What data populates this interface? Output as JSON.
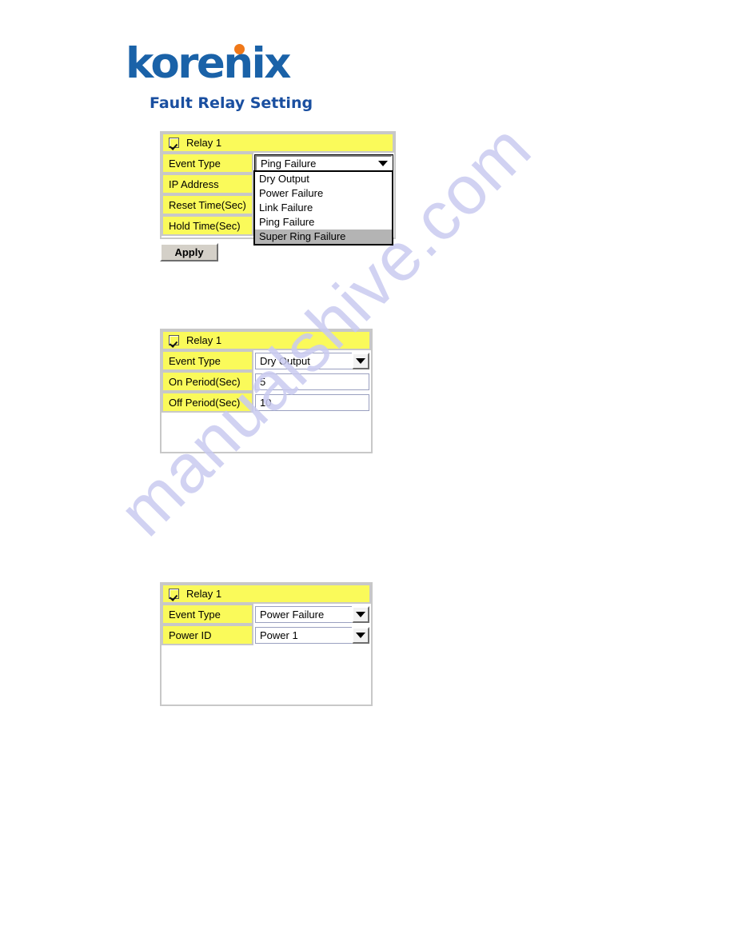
{
  "brand": {
    "logo_text": "korenix",
    "page_title": "Fault Relay Setting"
  },
  "watermark": {
    "text": "manualshive.com"
  },
  "panel1": {
    "header_label": "Relay 1",
    "rows": [
      {
        "label": "Event Type",
        "value": "Ping Failure"
      },
      {
        "label": "IP Address",
        "value": ""
      },
      {
        "label": "Reset Time(Sec)",
        "value": ""
      },
      {
        "label": "Hold Time(Sec)",
        "value": ""
      }
    ],
    "dropdown": {
      "options": [
        "Dry Output",
        "Power Failure",
        "Link Failure",
        "Ping Failure",
        "Super Ring Failure"
      ],
      "highlighted": "Super Ring Failure"
    },
    "apply_label": "Apply"
  },
  "panel2": {
    "header_label": "Relay 1",
    "rows": [
      {
        "label": "Event Type",
        "value": "Dry Output"
      },
      {
        "label": "On Period(Sec)",
        "value": "5"
      },
      {
        "label": "Off Period(Sec)",
        "value": "10"
      }
    ]
  },
  "panel3": {
    "header_label": "Relay 1",
    "rows": [
      {
        "label": "Event Type",
        "value": "Power Failure"
      },
      {
        "label": "Power ID",
        "value": "Power 1"
      }
    ]
  }
}
